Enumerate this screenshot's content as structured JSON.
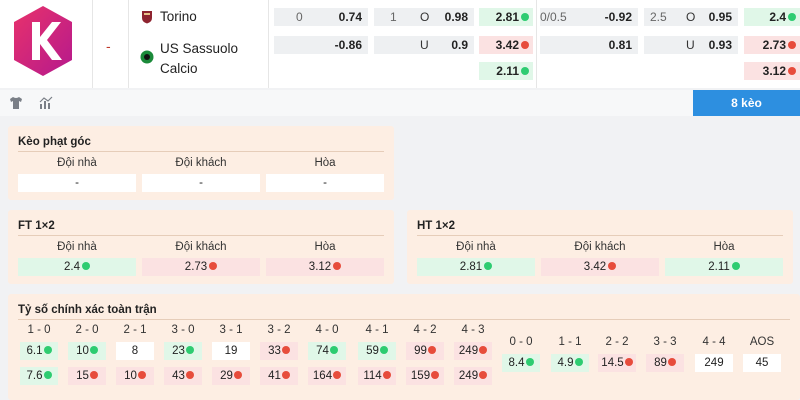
{
  "match": {
    "score_dash": "-",
    "home_team": "Torino",
    "away_team_line1": "US Sassuolo",
    "away_team_line2": "Calcio"
  },
  "odds_header": {
    "row1": {
      "hcap_home": "0",
      "hcap_home_val": "0.74",
      "ou_home": "1",
      "ou_label": "O",
      "ou_home_val": "0.98",
      "x12_home": "2.81",
      "ht_hcap": "0/0.5",
      "ht_hcap_val": "-0.92",
      "ht_ou": "2.5",
      "ht_ou_label": "O",
      "ht_ou_val": "0.95",
      "ht_x12": "2.4"
    },
    "row2": {
      "hcap_away_val": "-0.86",
      "ou_label": "U",
      "ou_away_val": "0.9",
      "x12_away": "3.42",
      "ht_hcap_val": "0.81",
      "ht_ou_label": "U",
      "ht_ou_val": "0.93",
      "ht_x12": "2.73"
    },
    "row3": {
      "x12_draw": "2.11",
      "ht_x12": "3.12"
    }
  },
  "tabs": {
    "keo_label": "8 kèo"
  },
  "corner": {
    "title": "Kèo phạt góc",
    "headers": [
      "Đội nhà",
      "Đội khách",
      "Hòa"
    ],
    "values": [
      "-",
      "-",
      "-"
    ]
  },
  "ft": {
    "title": "FT 1×2",
    "headers": [
      "Đội nhà",
      "Đội khách",
      "Hòa"
    ],
    "values": [
      "2.4",
      "2.73",
      "3.12"
    ]
  },
  "ht": {
    "title": "HT 1×2",
    "headers": [
      "Đội nhà",
      "Đội khách",
      "Hòa"
    ],
    "values": [
      "2.81",
      "3.42",
      "2.11"
    ]
  },
  "correct_score": {
    "title": "Tỷ số chính xác toàn trận",
    "left_headers": [
      "1 - 0",
      "2 - 0",
      "2 - 1",
      "3 - 0",
      "3 - 1",
      "3 - 2",
      "4 - 0",
      "4 - 1",
      "4 - 2",
      "4 - 3"
    ],
    "left_row1": [
      "6.1",
      "10",
      "8",
      "23",
      "19",
      "33",
      "74",
      "59",
      "99",
      "249"
    ],
    "left_row2": [
      "7.6",
      "15",
      "10",
      "43",
      "29",
      "41",
      "164",
      "114",
      "159",
      "249"
    ],
    "right_headers": [
      "0 - 0",
      "1 - 1",
      "2 - 2",
      "3 - 3",
      "4 - 4",
      "AOS"
    ],
    "right_row": [
      "8.4",
      "4.9",
      "14.5",
      "89",
      "249",
      "45"
    ]
  },
  "colors": {
    "accent": "#2d8fe0",
    "up": "#2ecc71",
    "down": "#e74c3c",
    "panel": "#fdeee3"
  }
}
